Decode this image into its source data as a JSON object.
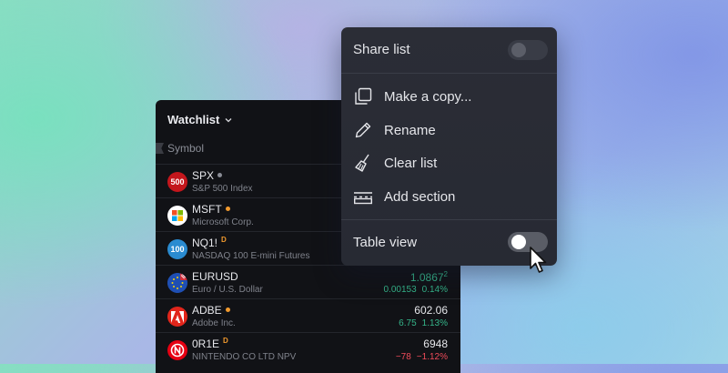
{
  "watchlist": {
    "title": "Watchlist",
    "column_label": "Symbol",
    "rows": [
      {
        "symbol": "SPX",
        "description": "S&P 500 Index",
        "marker": "dot-gray",
        "logo_text": "500",
        "logo_color": "#c4161c",
        "price": "",
        "change": "",
        "change_pct": ""
      },
      {
        "symbol": "MSFT",
        "description": "Microsoft Corp.",
        "marker": "dot-orange",
        "logo_text": "",
        "logo_color": "#ffffff",
        "price": "",
        "change": "",
        "change_pct": ""
      },
      {
        "symbol": "NQ1!",
        "description": "NASDAQ 100 E-mini Futures",
        "marker": "D",
        "logo_text": "100",
        "logo_color": "#2a8bd0",
        "price": "",
        "change": "",
        "change_pct": ""
      },
      {
        "symbol": "EURUSD",
        "description": "Euro / U.S. Dollar",
        "marker": "",
        "logo_text": "",
        "logo_color": "#1f4fb3",
        "price": "1.0867",
        "price_sup": "2",
        "change": "0.00153",
        "change_pct": "0.14%",
        "direction": "up"
      },
      {
        "symbol": "ADBE",
        "description": "Adobe Inc.",
        "marker": "dot-orange",
        "logo_text": "",
        "logo_color": "#e1251b",
        "price": "602.06",
        "change": "6.75",
        "change_pct": "1.13%",
        "direction": "up"
      },
      {
        "symbol": "0R1E",
        "description": "NINTENDO CO LTD NPV",
        "marker": "D",
        "logo_text": "N",
        "logo_color": "#e60012",
        "price": "6948",
        "change": "−78",
        "change_pct": "−1.12%",
        "direction": "down"
      }
    ]
  },
  "menu": {
    "share_label": "Share list",
    "share_enabled": false,
    "items": [
      {
        "label": "Make a copy...",
        "icon": "copy-icon"
      },
      {
        "label": "Rename",
        "icon": "pencil-icon"
      },
      {
        "label": "Clear list",
        "icon": "broom-icon"
      },
      {
        "label": "Add section",
        "icon": "section-icon"
      }
    ],
    "table_view_label": "Table view",
    "table_view_enabled": false
  },
  "colors": {
    "up": "#35b58a",
    "down": "#ef4b5a",
    "marker_orange": "#f29a2e",
    "menu_bg": "#2a2c35",
    "panel_bg": "#111216"
  }
}
